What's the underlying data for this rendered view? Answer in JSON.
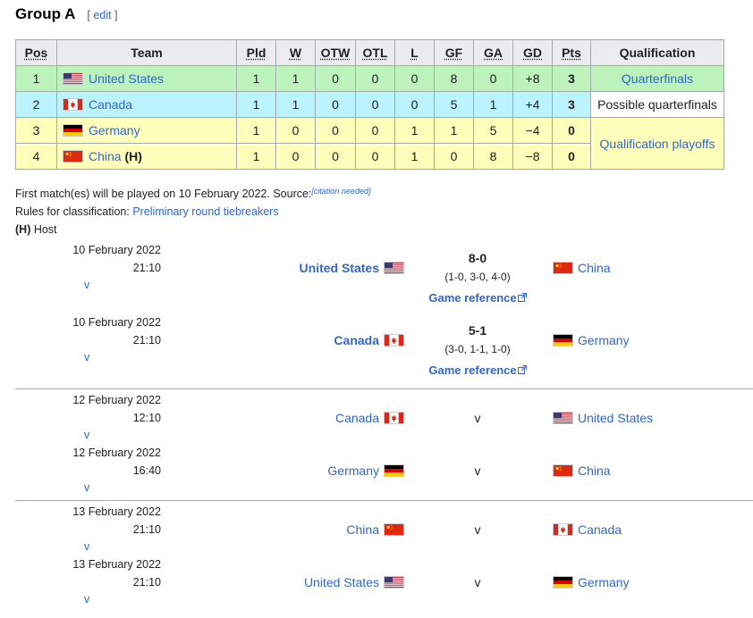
{
  "section": {
    "title": "Group A",
    "edit_label": "edit"
  },
  "table": {
    "headers": [
      "Pos",
      "Team",
      "Pld",
      "W",
      "OTW",
      "OTL",
      "L",
      "GF",
      "GA",
      "GD",
      "Pts",
      "Qualification"
    ],
    "rows": [
      {
        "pos": "1",
        "team": "United States",
        "flag": "us-flag",
        "host": "",
        "pld": "1",
        "w": "1",
        "otw": "0",
        "otl": "0",
        "l": "0",
        "gf": "8",
        "ga": "0",
        "gd": "+8",
        "pts": "3",
        "qualification": "Quarterfinals"
      },
      {
        "pos": "2",
        "team": "Canada",
        "flag": "canada-flag",
        "host": "",
        "pld": "1",
        "w": "1",
        "otw": "0",
        "otl": "0",
        "l": "0",
        "gf": "5",
        "ga": "1",
        "gd": "+4",
        "pts": "3",
        "qualification": "Possible quarterfinals"
      },
      {
        "pos": "3",
        "team": "Germany",
        "flag": "germany-flag",
        "host": "",
        "pld": "1",
        "w": "0",
        "otw": "0",
        "otl": "0",
        "l": "1",
        "gf": "1",
        "ga": "5",
        "gd": "−4",
        "pts": "0",
        "qualification": "Qualification playoffs"
      },
      {
        "pos": "4",
        "team": "China",
        "flag": "china-flag",
        "host": "(H)",
        "pld": "1",
        "w": "0",
        "otw": "0",
        "otl": "0",
        "l": "1",
        "gf": "0",
        "ga": "8",
        "gd": "−8",
        "pts": "0",
        "qualification": ""
      }
    ]
  },
  "notes": {
    "first_match": "First match(es) will be played on 10 February 2022. Source:",
    "citation": "[citation needed]",
    "rules_prefix": "Rules for classification: ",
    "rules_link": "Preliminary round tiebreakers",
    "host_abbr": "(H)",
    "host_label": " Host"
  },
  "matches": [
    {
      "date": "10 February 2022",
      "time": "21:10",
      "v": "v",
      "home": "United States",
      "home_flag": "us-flag",
      "away": "China",
      "away_flag": "china-flag",
      "score": "8-0",
      "periods": "(1-0, 3-0, 4-0)",
      "ref": "Game reference",
      "played": true
    },
    {
      "date": "10 February 2022",
      "time": "21:10",
      "v": "v",
      "home": "Canada",
      "home_flag": "canada-flag",
      "away": "Germany",
      "away_flag": "germany-flag",
      "score": "5-1",
      "periods": "(3-0, 1-1, 1-0)",
      "ref": "Game reference",
      "played": true
    },
    {
      "date": "12 February 2022",
      "time": "12:10",
      "v": "v",
      "home": "Canada",
      "home_flag": "canada-flag",
      "away": "United States",
      "away_flag": "us-flag",
      "score": "v",
      "played": false
    },
    {
      "date": "12 February 2022",
      "time": "16:40",
      "v": "v",
      "home": "Germany",
      "home_flag": "germany-flag",
      "away": "China",
      "away_flag": "china-flag",
      "score": "v",
      "played": false
    },
    {
      "date": "13 February 2022",
      "time": "21:10",
      "v": "v",
      "home": "China",
      "home_flag": "china-flag",
      "away": "Canada",
      "away_flag": "canada-flag",
      "score": "v",
      "played": false
    },
    {
      "date": "13 February 2022",
      "time": "21:10",
      "v": "v",
      "home": "United States",
      "home_flag": "us-flag",
      "away": "Germany",
      "away_flag": "germany-flag",
      "score": "v",
      "played": false
    }
  ],
  "colors": {
    "link": "#3366cc",
    "qualified": "#bbf3bb",
    "possible": "#bbf3ff",
    "playoff": "#ffffbb",
    "header": "#eaecf0"
  }
}
